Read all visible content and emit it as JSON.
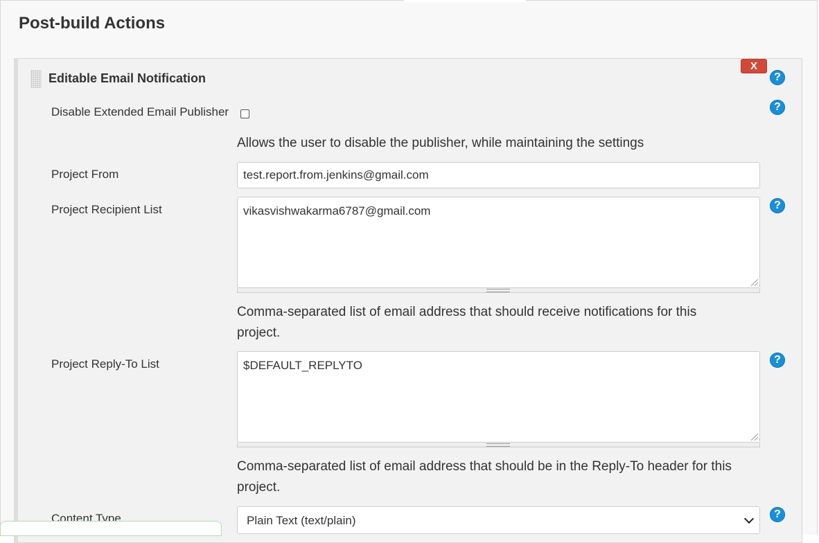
{
  "section": {
    "title": "Post-build Actions"
  },
  "publisher": {
    "title": "Editable Email Notification",
    "delete_label": "X",
    "help_symbol": "?",
    "fields": {
      "disable_publisher": {
        "label": "Disable Extended Email Publisher",
        "checked": false,
        "description": "Allows the user to disable the publisher, while maintaining the settings"
      },
      "project_from": {
        "label": "Project From",
        "value": "test.report.from.jenkins@gmail.com"
      },
      "recipient_list": {
        "label": "Project Recipient List",
        "value": "vikasvishwakarma6787@gmail.com",
        "description_line1": "Comma-separated list of email address that should receive notifications for this",
        "description_line2": "project."
      },
      "reply_to_list": {
        "label": "Project Reply-To List",
        "value": "$DEFAULT_REPLYTO",
        "description_line1": "Comma-separated list of email address that should be in the Reply-To header for this",
        "description_line2": "project."
      },
      "content_type": {
        "label": "Content Type",
        "selected": "Plain Text (text/plain)"
      }
    }
  },
  "colors": {
    "help_icon": "#1a8fd8",
    "delete_button": "#d24939",
    "panel_background": "#f2f2f2"
  }
}
